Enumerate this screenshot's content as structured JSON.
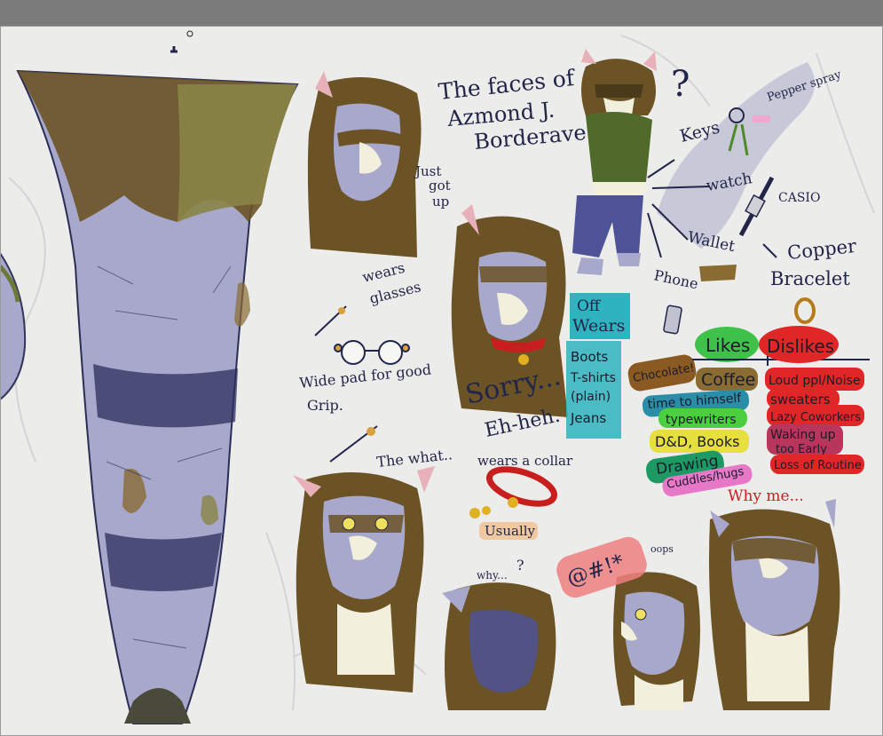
{
  "colors": {
    "topbar": "#7a7a7a",
    "paper": "#ececeb",
    "fur_blue": "#a7a8cc",
    "fur_brown": "#6b5326",
    "fur_olive": "#8a8447",
    "ink": "#22254a",
    "off_wears_bg": "#2fb3bf",
    "likes_bg": "#3fc24a",
    "dislikes_bg": "#e02626",
    "chocolate_bg": "#8a5a22",
    "coffee_bg": "#8a6c32",
    "time_bg": "#2b8ea8",
    "typewriters_bg": "#4ccf3e",
    "dnd_bg": "#e7df3f",
    "drawing_bg": "#1d9a63",
    "cuddles_bg": "#e777c7",
    "collar_red": "#c81e1e",
    "bell_gold": "#e0b020",
    "usually_bg": "#f1c9a0"
  },
  "title": {
    "line1": "The faces of",
    "line2": "Azmond J.",
    "line3": "Borderave"
  },
  "notes": {
    "just_got_up": [
      "Just",
      "got",
      "up"
    ],
    "wears_glasses": [
      "wears",
      "glasses"
    ],
    "wide_pad": [
      "Wide pad for good",
      "Grip."
    ],
    "sorry": "Sorry...",
    "eh_heh": "Eh-heh.",
    "the_what": "The what..",
    "wears_collar": "wears a collar",
    "usually": "Usually",
    "why_dots": "why...",
    "why_me": "Why me...",
    "question_mark": "?",
    "oops": "oops",
    "curse": "@#!*"
  },
  "items": {
    "keys": "Keys",
    "pepper_spray": "Pepper spray",
    "watch": "watch",
    "casio": "CASIO",
    "wallet": "Wallet",
    "phone": "Phone",
    "copper_bracelet": [
      "Copper",
      "Bracelet"
    ]
  },
  "off_wears": {
    "title": [
      "Off",
      "Wears"
    ],
    "list": [
      "Boots",
      "T-shirts",
      "(plain)",
      "Jeans"
    ]
  },
  "likes": {
    "title": "Likes",
    "list": [
      "Chocolate!",
      "Coffee",
      "time to himself",
      "typewriters",
      "D&D, Books",
      "Drawing",
      "Cuddles/hugs"
    ]
  },
  "dislikes": {
    "title": "Dislikes",
    "list": [
      "Loud ppl/Noise",
      "sweaters",
      "Lazy Coworkers",
      "Waking up",
      "too Early",
      "Loss of Routine"
    ]
  }
}
